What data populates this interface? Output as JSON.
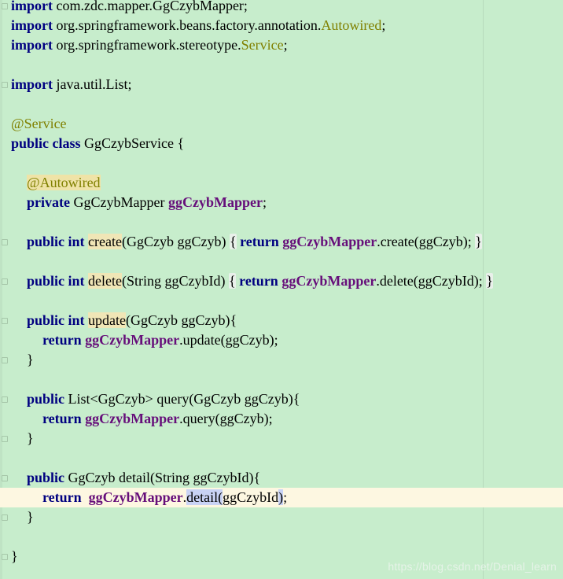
{
  "editor": {
    "lines": [
      {
        "id": "imp1",
        "tokens": [
          {
            "t": "import",
            "c": "kw"
          },
          {
            "t": " com.zdc.mapper.GgCzybMapper;"
          }
        ]
      },
      {
        "id": "imp2",
        "tokens": [
          {
            "t": "import",
            "c": "kw"
          },
          {
            "t": " org.springframework.beans.factory.annotation."
          },
          {
            "t": "Autowired",
            "c": "ann"
          },
          {
            "t": ";"
          }
        ]
      },
      {
        "id": "imp3",
        "tokens": [
          {
            "t": "import",
            "c": "kw"
          },
          {
            "t": " org.springframework.stereotype."
          },
          {
            "t": "Service",
            "c": "ann"
          },
          {
            "t": ";"
          }
        ]
      },
      {
        "id": "blank1",
        "tokens": []
      },
      {
        "id": "imp4",
        "tokens": [
          {
            "t": "import",
            "c": "kw"
          },
          {
            "t": " java.util.List;"
          }
        ]
      },
      {
        "id": "blank2",
        "tokens": []
      },
      {
        "id": "ann-service",
        "tokens": [
          {
            "t": "@Service",
            "c": "ann"
          }
        ]
      },
      {
        "id": "class-decl",
        "tokens": [
          {
            "t": "public",
            "c": "kw"
          },
          {
            "t": " "
          },
          {
            "t": "class",
            "c": "kw"
          },
          {
            "t": " GgCzybService {"
          }
        ]
      },
      {
        "id": "blank3",
        "tokens": []
      },
      {
        "id": "ann-autowired",
        "indent": 1,
        "tokens": [
          {
            "t": "@Autowired",
            "c": "ann hl-annot"
          }
        ]
      },
      {
        "id": "field-decl",
        "indent": 1,
        "tokens": [
          {
            "t": "private",
            "c": "kw"
          },
          {
            "t": " GgCzybMapper "
          },
          {
            "t": "ggCzybMapper",
            "c": "fld"
          },
          {
            "t": ";"
          }
        ]
      },
      {
        "id": "blank4",
        "tokens": []
      },
      {
        "id": "m-create",
        "indent": 1,
        "tokens": [
          {
            "t": "public",
            "c": "kw"
          },
          {
            "t": " "
          },
          {
            "t": "int",
            "c": "kw"
          },
          {
            "t": " "
          },
          {
            "t": "create",
            "c": "hl-usage"
          },
          {
            "t": "(GgCzyb ggCzyb) "
          },
          {
            "t": "{",
            "c": "brace-box"
          },
          {
            "t": " "
          },
          {
            "t": "return",
            "c": "kw"
          },
          {
            "t": " "
          },
          {
            "t": "ggCzybMapper",
            "c": "fld"
          },
          {
            "t": ".create(ggCzyb); "
          },
          {
            "t": "}",
            "c": "brace-box"
          }
        ]
      },
      {
        "id": "blank5",
        "tokens": []
      },
      {
        "id": "m-delete",
        "indent": 1,
        "tokens": [
          {
            "t": "public",
            "c": "kw"
          },
          {
            "t": " "
          },
          {
            "t": "int",
            "c": "kw"
          },
          {
            "t": " "
          },
          {
            "t": "delete",
            "c": "hl-usage"
          },
          {
            "t": "(String ggCzybId) "
          },
          {
            "t": "{",
            "c": "brace-box"
          },
          {
            "t": " "
          },
          {
            "t": "return",
            "c": "kw"
          },
          {
            "t": " "
          },
          {
            "t": "ggCzybMapper",
            "c": "fld"
          },
          {
            "t": ".delete(ggCzybId); "
          },
          {
            "t": "}",
            "c": "brace-box"
          }
        ]
      },
      {
        "id": "blank6",
        "tokens": []
      },
      {
        "id": "m-update",
        "indent": 1,
        "tokens": [
          {
            "t": "public",
            "c": "kw"
          },
          {
            "t": " "
          },
          {
            "t": "int",
            "c": "kw"
          },
          {
            "t": " "
          },
          {
            "t": "update",
            "c": "hl-usage"
          },
          {
            "t": "(GgCzyb ggCzyb){"
          }
        ]
      },
      {
        "id": "m-update-body",
        "indent": 2,
        "tokens": [
          {
            "t": "return",
            "c": "kw"
          },
          {
            "t": " "
          },
          {
            "t": "ggCzybMapper",
            "c": "fld"
          },
          {
            "t": ".update(ggCzyb);"
          }
        ]
      },
      {
        "id": "m-update-end",
        "indent": 1,
        "tokens": [
          {
            "t": "}"
          }
        ]
      },
      {
        "id": "blank7",
        "tokens": []
      },
      {
        "id": "m-query",
        "indent": 1,
        "tokens": [
          {
            "t": "public",
            "c": "kw"
          },
          {
            "t": " List<GgCzyb> query(GgCzyb ggCzyb){"
          }
        ]
      },
      {
        "id": "m-query-body",
        "indent": 2,
        "tokens": [
          {
            "t": "return",
            "c": "kw"
          },
          {
            "t": " "
          },
          {
            "t": "ggCzybMapper",
            "c": "fld"
          },
          {
            "t": ".query(ggCzyb);"
          }
        ]
      },
      {
        "id": "m-query-end",
        "indent": 1,
        "tokens": [
          {
            "t": "}"
          }
        ]
      },
      {
        "id": "blank8",
        "tokens": []
      },
      {
        "id": "m-detail",
        "indent": 1,
        "tokens": [
          {
            "t": "public",
            "c": "kw"
          },
          {
            "t": " GgCzyb detail(String ggCzybId){"
          }
        ]
      },
      {
        "id": "m-detail-body",
        "indent": 2,
        "current": true,
        "tokens": [
          {
            "t": "return",
            "c": "kw"
          },
          {
            "t": "  "
          },
          {
            "t": "ggCzybMapper",
            "c": "fld"
          },
          {
            "t": "."
          },
          {
            "t": "detail(",
            "c": "caret-sel"
          },
          {
            "t": "ggCzybId"
          },
          {
            "t": ")",
            "c": "caret-sel"
          },
          {
            "t": ";"
          }
        ]
      },
      {
        "id": "m-detail-end",
        "indent": 1,
        "tokens": [
          {
            "t": "}"
          }
        ]
      },
      {
        "id": "blank9",
        "tokens": []
      },
      {
        "id": "class-end",
        "tokens": [
          {
            "t": "}"
          }
        ]
      }
    ]
  },
  "watermark": "https://blog.csdn.net/Denial_learn",
  "colors": {
    "background": "#c7edcc",
    "keyword": "#000080",
    "annotation": "#808000",
    "field": "#660e7a",
    "current_line": "#fdf7e1"
  }
}
